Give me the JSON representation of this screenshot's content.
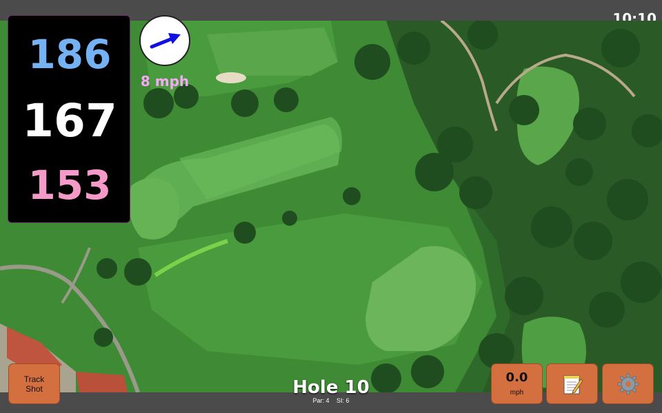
{
  "status_bar": {
    "time": "10:10"
  },
  "distances": {
    "back": "186",
    "middle": "167",
    "front": "153",
    "back_color": "#74b2f4",
    "middle_color": "#ffffff",
    "front_color": "#f49ac8"
  },
  "wind": {
    "speed_label": "8 mph",
    "label_color": "#f4a8f6",
    "arrow_color": "#1010e0",
    "direction_icon": "arrow-right-icon"
  },
  "buttons": {
    "track_shot_label": "Track Shot",
    "speed_value": "0.0",
    "speed_unit": "mph",
    "notes_icon": "notepad-icon",
    "settings_icon": "gear-icon",
    "button_color": "#d46f3f"
  },
  "hole": {
    "title": "Hole 10",
    "par": "Par: 4",
    "si": "SI: 6"
  }
}
